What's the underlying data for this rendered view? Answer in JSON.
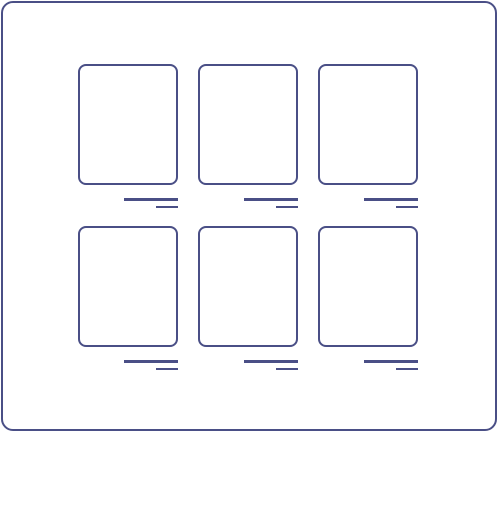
{
  "theme": {
    "stroke_color": "#4a4f86",
    "background_color": "#ffffff"
  },
  "grid": {
    "rows": 2,
    "columns": 3,
    "cards": [
      {
        "label": ""
      },
      {
        "label": ""
      },
      {
        "label": ""
      },
      {
        "label": ""
      },
      {
        "label": ""
      },
      {
        "label": ""
      }
    ]
  }
}
